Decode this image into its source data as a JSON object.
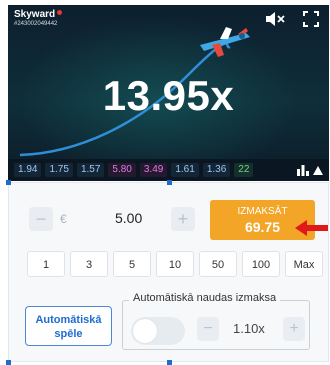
{
  "game": {
    "title": "Skyward",
    "round_id": "#243002049442",
    "multiplier": "13.95x",
    "history": [
      {
        "value": "1.94",
        "tone": "blue"
      },
      {
        "value": "1.75",
        "tone": "blue"
      },
      {
        "value": "1.57",
        "tone": "blue"
      },
      {
        "value": "5.80",
        "tone": "pink"
      },
      {
        "value": "3.49",
        "tone": "pink"
      },
      {
        "value": "1.61",
        "tone": "blue"
      },
      {
        "value": "1.36",
        "tone": "blue"
      },
      {
        "value": "22",
        "tone": "green"
      }
    ],
    "icons": {
      "mute": "speaker-muted-icon",
      "fullscreen": "fullscreen-icon",
      "stats": "bar-chart-icon",
      "expand": "triangle-up-icon"
    }
  },
  "bet": {
    "currency": "€",
    "amount": "5.00",
    "minus": "−",
    "plus": "+",
    "cashout_label": "IZMAKSĀT",
    "cashout_value": "69.75",
    "quick_amounts": [
      "1",
      "3",
      "5",
      "10",
      "50",
      "100",
      "Max"
    ]
  },
  "auto": {
    "button_line1": "Automātiskā",
    "button_line2": "spēle",
    "cashout_label": "Automātiskā naudas izmaksa",
    "value": "1.10x",
    "minus": "−",
    "plus": "+",
    "enabled": false
  },
  "colors": {
    "accent_orange": "#f2a526",
    "accent_blue": "#1f6cd1",
    "arrow_red": "#e0191b"
  }
}
